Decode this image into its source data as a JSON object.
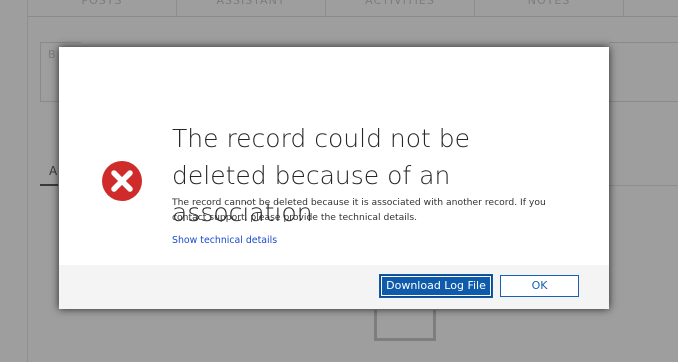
{
  "background": {
    "tabs": [
      "POSTS",
      "ASSISTANT",
      "ACTIVITIES",
      "NOTES"
    ],
    "field_letter": "B",
    "subtab_letter": "A"
  },
  "dialog": {
    "icon": "error-circle-x-icon",
    "title": "The record could not be deleted because of an association",
    "message": "The record cannot be deleted because it is associated with another record. If you contact support, please provide the technical details.",
    "technical_link": "Show technical details",
    "buttons": {
      "download": "Download Log File",
      "ok": "OK"
    }
  },
  "colors": {
    "error_red": "#d02b2b",
    "primary_button": "#0e5bab",
    "link": "#1a4bd1"
  }
}
